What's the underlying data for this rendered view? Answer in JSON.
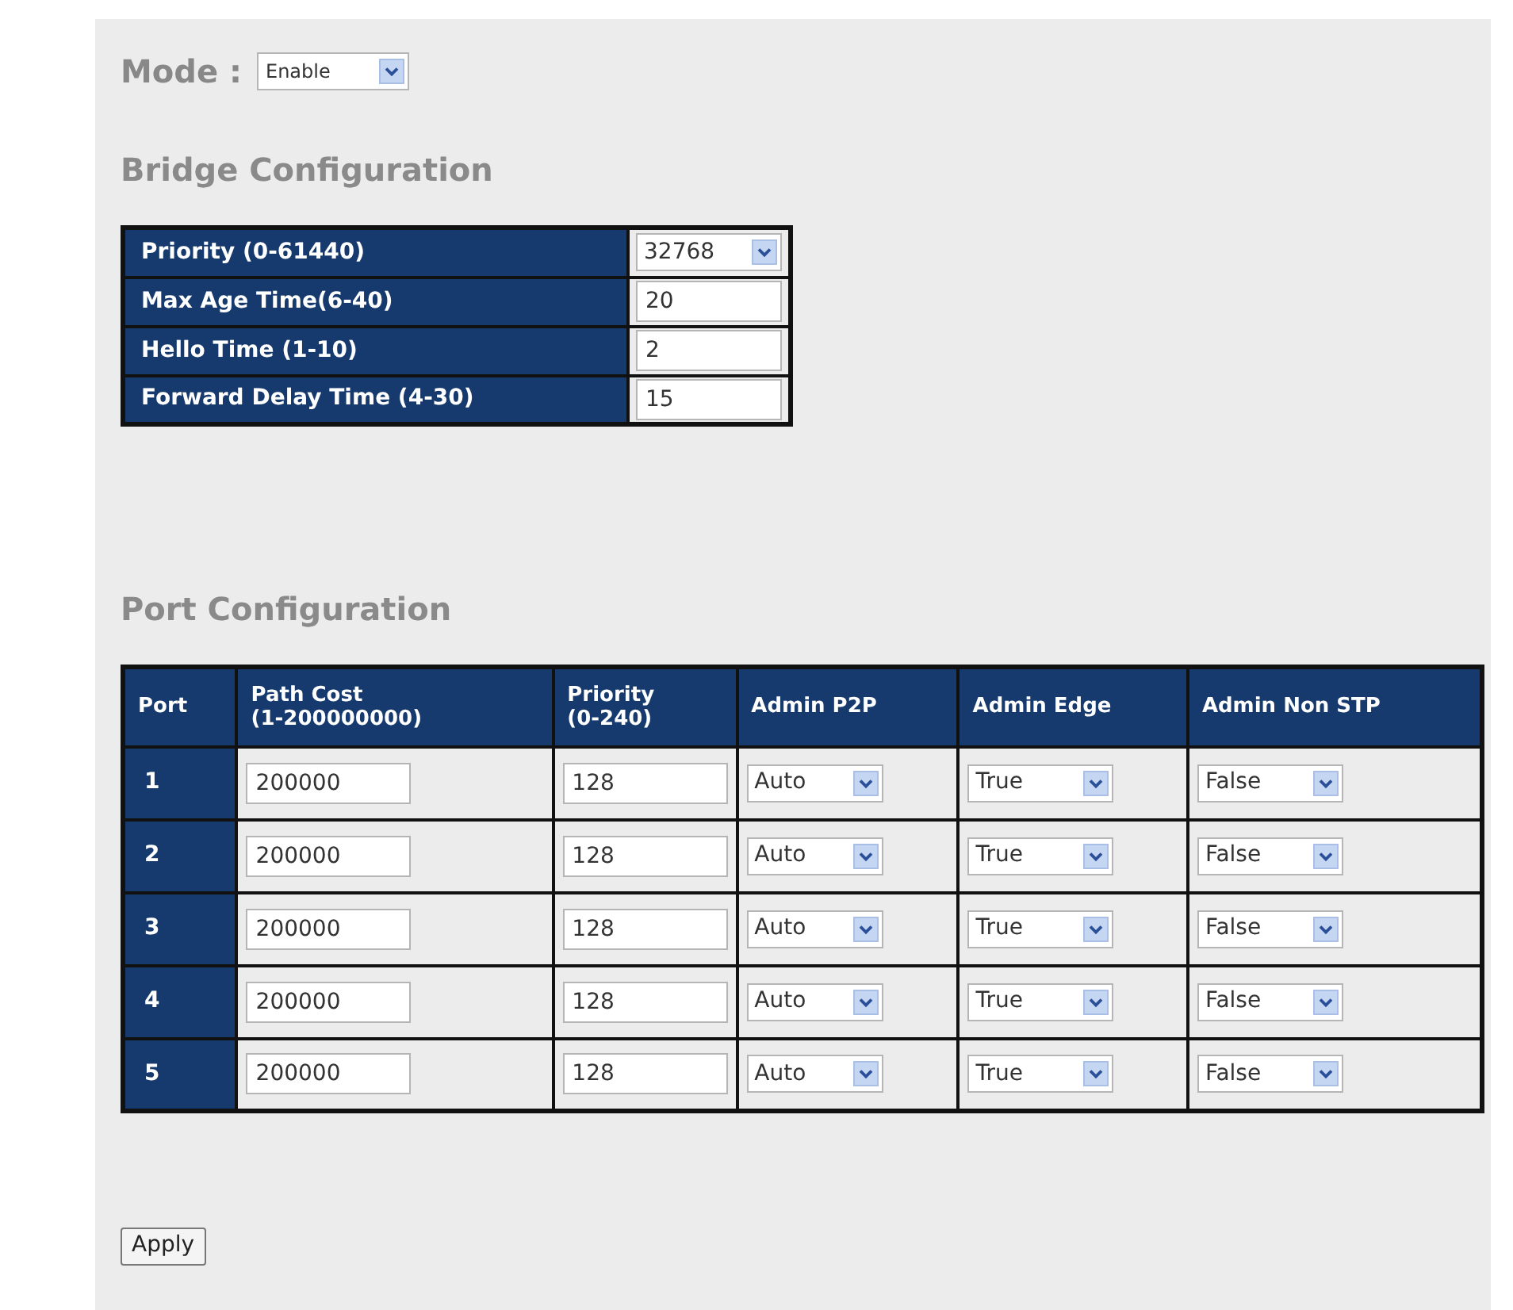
{
  "mode": {
    "label": "Mode :",
    "value": "Enable"
  },
  "bridge": {
    "title": "Bridge Configuration",
    "rows": [
      {
        "label": "Priority (0-61440)",
        "kind": "select",
        "value": "32768"
      },
      {
        "label": "Max Age Time(6-40)",
        "kind": "input",
        "value": "20"
      },
      {
        "label": "Hello Time (1-10)",
        "kind": "input",
        "value": "2"
      },
      {
        "label": "Forward Delay Time (4-30)",
        "kind": "input",
        "value": "15"
      }
    ]
  },
  "ports": {
    "title": "Port Configuration",
    "columns": [
      "Port",
      "Path Cost\n(1-200000000)",
      "Priority\n(0-240)",
      "Admin P2P",
      "Admin Edge",
      "Admin Non STP"
    ],
    "rows": [
      {
        "port": "1",
        "path_cost": "200000",
        "priority": "128",
        "admin_p2p": "Auto",
        "admin_edge": "True",
        "admin_non_stp": "False"
      },
      {
        "port": "2",
        "path_cost": "200000",
        "priority": "128",
        "admin_p2p": "Auto",
        "admin_edge": "True",
        "admin_non_stp": "False"
      },
      {
        "port": "3",
        "path_cost": "200000",
        "priority": "128",
        "admin_p2p": "Auto",
        "admin_edge": "True",
        "admin_non_stp": "False"
      },
      {
        "port": "4",
        "path_cost": "200000",
        "priority": "128",
        "admin_p2p": "Auto",
        "admin_edge": "True",
        "admin_non_stp": "False"
      },
      {
        "port": "5",
        "path_cost": "200000",
        "priority": "128",
        "admin_p2p": "Auto",
        "admin_edge": "True",
        "admin_non_stp": "False"
      }
    ]
  },
  "apply_button": "Apply"
}
